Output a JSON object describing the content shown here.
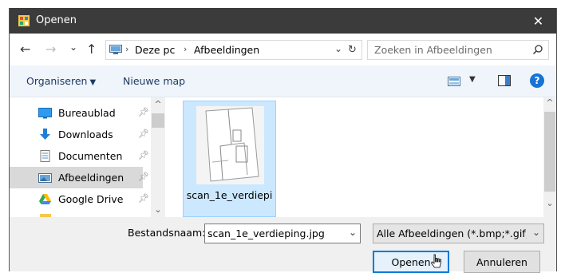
{
  "window": {
    "title": "Openen",
    "close_glyph": "✕"
  },
  "nav": {
    "back_glyph": "←",
    "forward_glyph": "→",
    "recent_glyph": "⌄",
    "up_glyph": "↑",
    "breadcrumb": [
      "Deze pc",
      "Afbeeldingen"
    ],
    "sep_glyph": "›",
    "refresh_glyph": "↻",
    "chevron_glyph": "⌄"
  },
  "search": {
    "placeholder": "Zoeken in Afbeeldingen"
  },
  "commands": {
    "organize": "Organiseren",
    "new_folder": "Nieuwe map",
    "help": "?"
  },
  "sidebar": {
    "items": [
      {
        "label": "Bureaublad",
        "icon": "desktop-icon",
        "pinned": true
      },
      {
        "label": "Downloads",
        "icon": "download-icon",
        "pinned": true
      },
      {
        "label": "Documenten",
        "icon": "documents-icon",
        "pinned": true
      },
      {
        "label": "Afbeeldingen",
        "icon": "pictures-icon",
        "pinned": true,
        "selected": true
      },
      {
        "label": "Google Drive",
        "icon": "google-drive-icon",
        "pinned": true
      }
    ]
  },
  "files": [
    {
      "name": "scan_1e_verdiepi"
    }
  ],
  "footer": {
    "filename_label": "Bestandsnaam:",
    "filename_value": "scan_1e_verdieping.jpg",
    "filter_value": "Alle Afbeeldingen (*.bmp;*.gif;*.jpg;*.jpeg;*.png)",
    "open_label": "Openen",
    "cancel_label": "Annuleren"
  },
  "colors": {
    "titlebar": "#3b3b3b",
    "accent": "#0078d7",
    "selection": "#cce8ff",
    "commandbar": "#f0f5fb"
  }
}
